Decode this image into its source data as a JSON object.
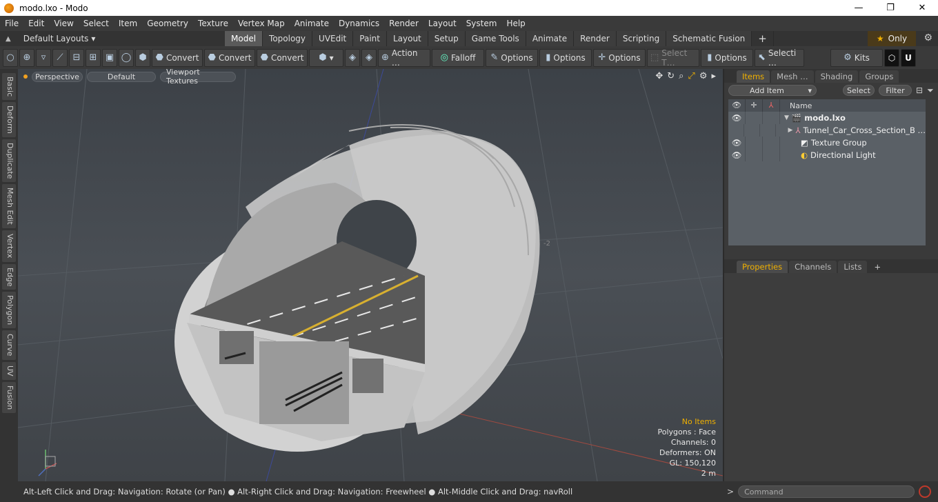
{
  "window": {
    "title": "modo.lxo - Modo",
    "min": "—",
    "max": "❐",
    "close": "✕"
  },
  "menu": [
    "File",
    "Edit",
    "View",
    "Select",
    "Item",
    "Geometry",
    "Texture",
    "Vertex Map",
    "Animate",
    "Dynamics",
    "Render",
    "Layout",
    "System",
    "Help"
  ],
  "layouts": {
    "label": "Default Layouts",
    "arrow": "▾"
  },
  "tabs": [
    {
      "label": "Model",
      "active": true
    },
    {
      "label": "Topology"
    },
    {
      "label": "UVEdit"
    },
    {
      "label": "Paint"
    },
    {
      "label": "Layout"
    },
    {
      "label": "Setup"
    },
    {
      "label": "Game Tools"
    },
    {
      "label": "Animate"
    },
    {
      "label": "Render"
    },
    {
      "label": "Scripting"
    },
    {
      "label": "Schematic Fusion"
    }
  ],
  "tabs_add": "+",
  "only": {
    "star": "★",
    "label": "Only"
  },
  "toolbar": {
    "convert1": "Convert",
    "convert2": "Convert",
    "convert3": "Convert",
    "action": "Action …",
    "falloff": "Falloff",
    "options1": "Options",
    "options2": "Options",
    "options3": "Options",
    "select_t": "Select T…",
    "options4": "Options",
    "selecti": "Selecti …",
    "kits": "Kits"
  },
  "left_tabs": [
    "Basic",
    "Deform",
    "Duplicate",
    "Mesh Edit",
    "Vertex",
    "Edge",
    "Polygon",
    "Curve",
    "UV",
    "Fusion"
  ],
  "viewport": {
    "view": "Perspective",
    "shading": "Default",
    "textures": "Viewport Textures",
    "axis_mark": "-2",
    "hud": {
      "items": "No Items",
      "polygons": "Polygons : Face",
      "channels": "Channels: 0",
      "deformers": "Deformers: ON",
      "gl": "GL: 150,120",
      "scale": "2 m"
    }
  },
  "items_panel": {
    "tabs": [
      {
        "label": "Items",
        "active": true
      },
      {
        "label": "Mesh …"
      },
      {
        "label": "Shading"
      },
      {
        "label": "Groups"
      }
    ],
    "add_item": "Add Item",
    "select": "Select",
    "filter": "Filter",
    "name_col": "Name",
    "rows": [
      {
        "name": "modo.lxo",
        "bold": true,
        "eye": "👁",
        "expander": "▼"
      },
      {
        "name": "Tunnel_Car_Cross_Section_B …",
        "eye": "",
        "expander": "▶"
      },
      {
        "name": "Texture Group",
        "eye": "👁",
        "expander": ""
      },
      {
        "name": "Directional Light",
        "eye": "👁",
        "expander": ""
      }
    ]
  },
  "props_panel": {
    "tabs": [
      {
        "label": "Properties",
        "active": true
      },
      {
        "label": "Channels"
      },
      {
        "label": "Lists"
      }
    ],
    "add": "+"
  },
  "status": {
    "hint": "Alt-Left Click and Drag: Navigation: Rotate (or Pan) ● Alt-Right Click and Drag: Navigation: Freewheel ● Alt-Middle Click and Drag: navRoll",
    "command_prompt": ">",
    "command_placeholder": "Command"
  },
  "colors": {
    "accent": "#f0b000",
    "viewport_bg": "#4a4f55",
    "concrete": "#c8c8c8",
    "road": "#5a5a5a",
    "lane_yellow": "#d8b030"
  }
}
